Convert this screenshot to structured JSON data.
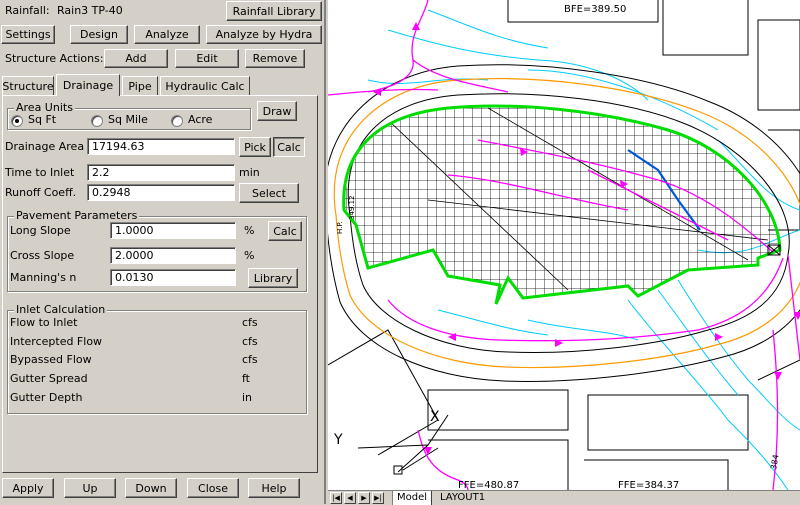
{
  "header": {
    "rainfall_label": "Rainfall:",
    "rainfall_value": "Rain3 TP-40",
    "rainfall_library_button": "Rainfall Library"
  },
  "toolbar": {
    "settings": "Settings",
    "design": "Design",
    "analyze": "Analyze",
    "analyze_by_hydra": "Analyze by Hydra"
  },
  "structure_actions": {
    "label": "Structure Actions:",
    "add": "Add",
    "edit": "Edit",
    "remove": "Remove"
  },
  "tabs": [
    "Structure",
    "Drainage",
    "Pipe",
    "Hydraulic Calc"
  ],
  "active_tab": "Drainage",
  "area_units": {
    "title": "Area Units",
    "options": [
      "Sq Ft",
      "Sq Mile",
      "Acre"
    ],
    "selected": "Sq Ft",
    "draw_button": "Draw"
  },
  "drainage": {
    "area_label": "Drainage Area",
    "area_value": "17194.63",
    "pick_button": "Pick",
    "calc_button": "Calc",
    "time_label": "Time to Inlet",
    "time_value": "2.2",
    "time_unit": "min",
    "runoff_label": "Runoff Coeff.",
    "runoff_value": "0.2948",
    "select_button": "Select"
  },
  "pavement": {
    "title": "Pavement Parameters",
    "long_slope_label": "Long Slope",
    "long_slope_value": "1.0000",
    "long_slope_unit": "%",
    "calc_button": "Calc",
    "cross_slope_label": "Cross Slope",
    "cross_slope_value": "2.0000",
    "cross_slope_unit": "%",
    "mannings_label": "Manning's n",
    "mannings_value": "0.0130",
    "library_button": "Library"
  },
  "inlet": {
    "title": "Inlet Calculation",
    "rows": [
      {
        "label": "Flow to Inlet",
        "unit": "cfs"
      },
      {
        "label": "Intercepted Flow",
        "unit": "cfs"
      },
      {
        "label": "Bypassed Flow",
        "unit": "cfs"
      },
      {
        "label": "Gutter Spread",
        "unit": "ft"
      },
      {
        "label": "Gutter Depth",
        "unit": "in"
      }
    ]
  },
  "footer": {
    "apply": "Apply",
    "up": "Up",
    "down": "Down",
    "close": "Close",
    "help": "Help"
  },
  "cad": {
    "bfe_label": "BFE=389.50",
    "ffe_label_left": "FFE=480.87",
    "ffe_label_right": "FFE=384.37",
    "hp_label": "H.P.",
    "elev_label": "349.12",
    "contour_label": "384",
    "axis_x": "X",
    "axis_y": "Y",
    "colors": {
      "drainage_boundary": "#00dd00",
      "flow_path": "#ff00ff",
      "contour": "#00ccff",
      "curb": "#ff9900",
      "pipe": "#0055dd"
    }
  },
  "layout_tabs": [
    "Model",
    "LAYOUT1"
  ],
  "active_layout": "Model"
}
